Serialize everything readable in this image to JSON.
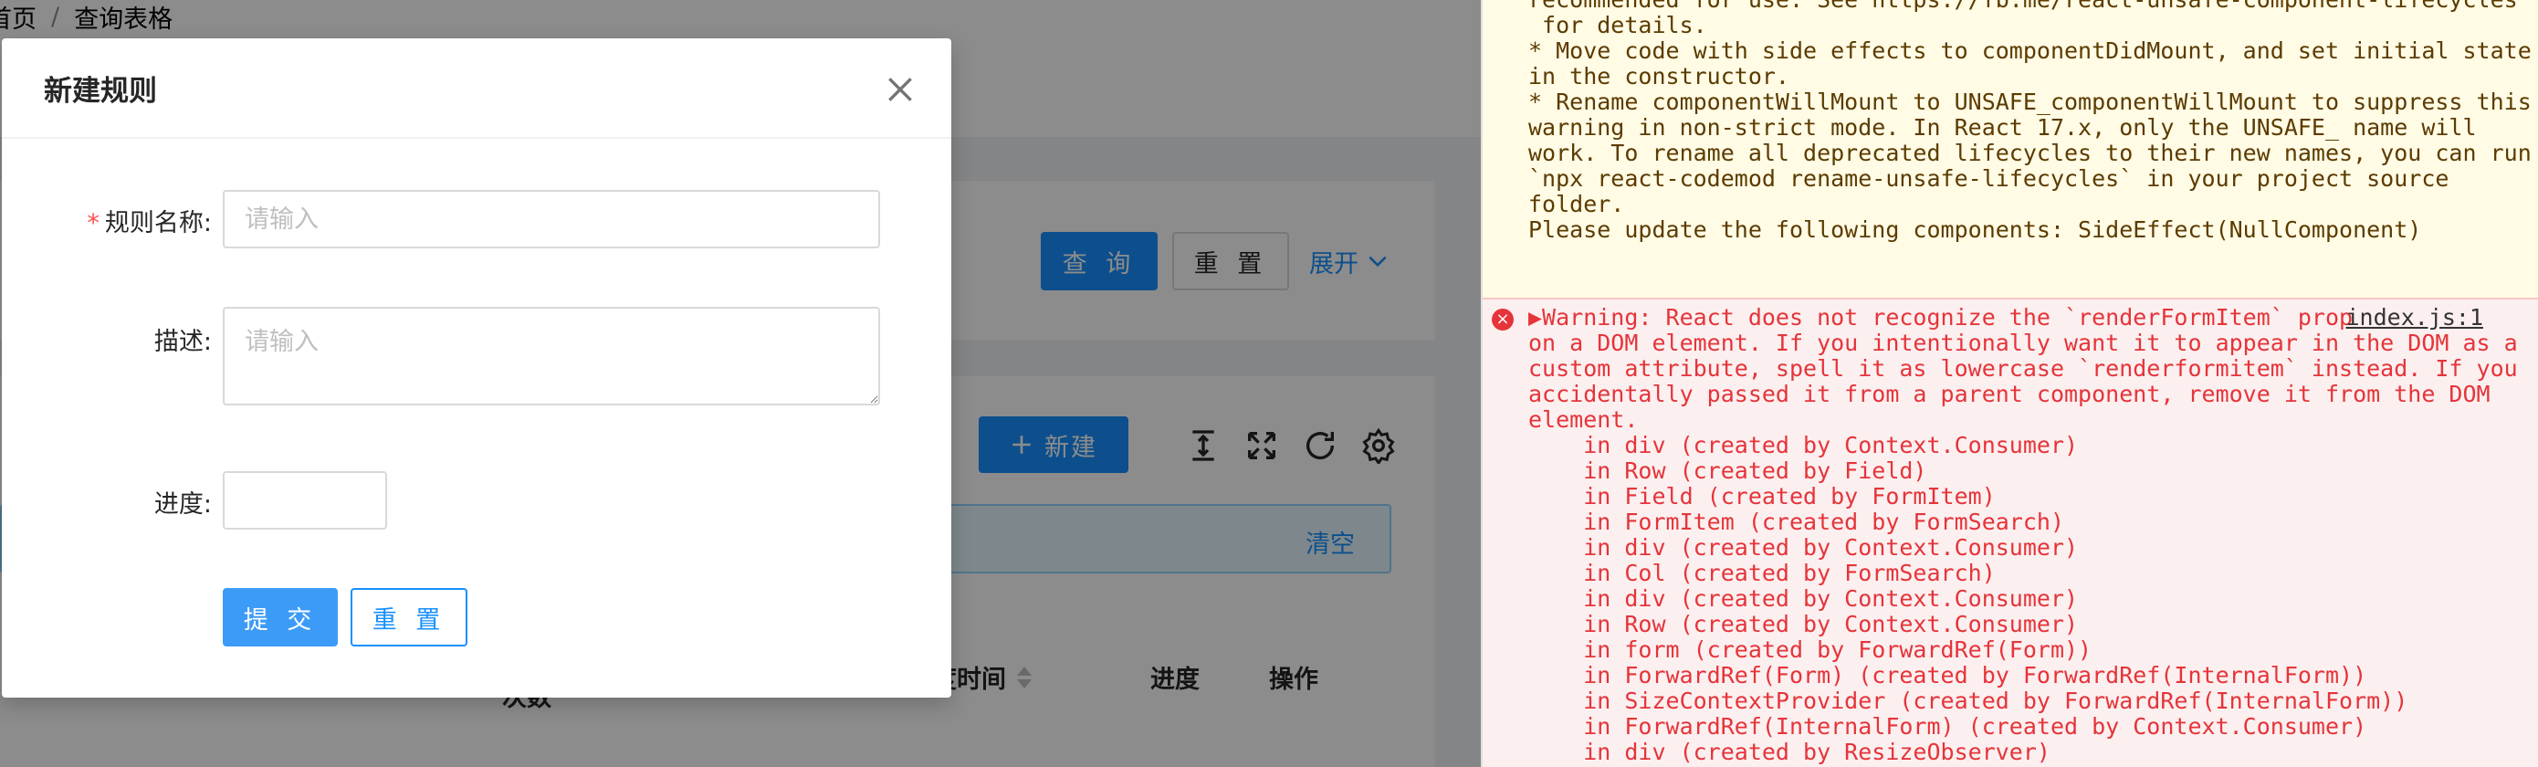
{
  "breadcrumb": {
    "home": "首页",
    "current": "查询表格"
  },
  "search": {
    "query_label": "查 询",
    "reset_label": "重 置",
    "expand_label": "展开"
  },
  "table_toolbar": {
    "new_label": "新建"
  },
  "alert": {
    "clear_label": "清空"
  },
  "table": {
    "headers": [
      "次数",
      "上次调度时间",
      "进度",
      "操作"
    ]
  },
  "modal": {
    "title": "新建规则",
    "fields": {
      "name": {
        "label": "规则名称",
        "placeholder": "请输入",
        "required": true
      },
      "desc": {
        "label": "描述",
        "placeholder": "请输入"
      },
      "progress": {
        "label": "进度",
        "value": ""
      }
    },
    "submit_label": "提 交",
    "reset_label": "重 置"
  },
  "console": {
    "warning_lines": [
      "recommended for use. See https://fb.me/react-unsafe-component-lifecycles",
      " for details.",
      "",
      "* Move code with side effects to componentDidMount, and set initial state",
      "in the constructor.",
      "* Rename componentWillMount to UNSAFE_componentWillMount to suppress this",
      "warning in non-strict mode. In React 17.x, only the UNSAFE_ name will",
      "work. To rename all deprecated lifecycles to their new names, you can run",
      "`npx react-codemod rename-unsafe-lifecycles` in your project source",
      "folder.",
      "",
      "Please update the following components: SideEffect(NullComponent)"
    ],
    "error_file": "index.js:1",
    "error_lines": [
      "▶Warning: React does not recognize the `renderFormItem` prop",
      "on a DOM element. If you intentionally want it to appear in the DOM as a",
      "custom attribute, spell it as lowercase `renderformitem` instead. If you",
      "accidentally passed it from a parent component, remove it from the DOM",
      "element.",
      "    in div (created by Context.Consumer)",
      "    in Row (created by Field)",
      "    in Field (created by FormItem)",
      "    in FormItem (created by FormSearch)",
      "    in div (created by Context.Consumer)",
      "    in Col (created by FormSearch)",
      "    in div (created by Context.Consumer)",
      "    in Row (created by Context.Consumer)",
      "    in form (created by ForwardRef(Form))",
      "    in ForwardRef(Form) (created by ForwardRef(InternalForm))",
      "    in SizeContextProvider (created by ForwardRef(InternalForm))",
      "    in ForwardRef(InternalForm) (created by Context.Consumer)",
      "    in div (created by ResizeObserver)"
    ]
  }
}
